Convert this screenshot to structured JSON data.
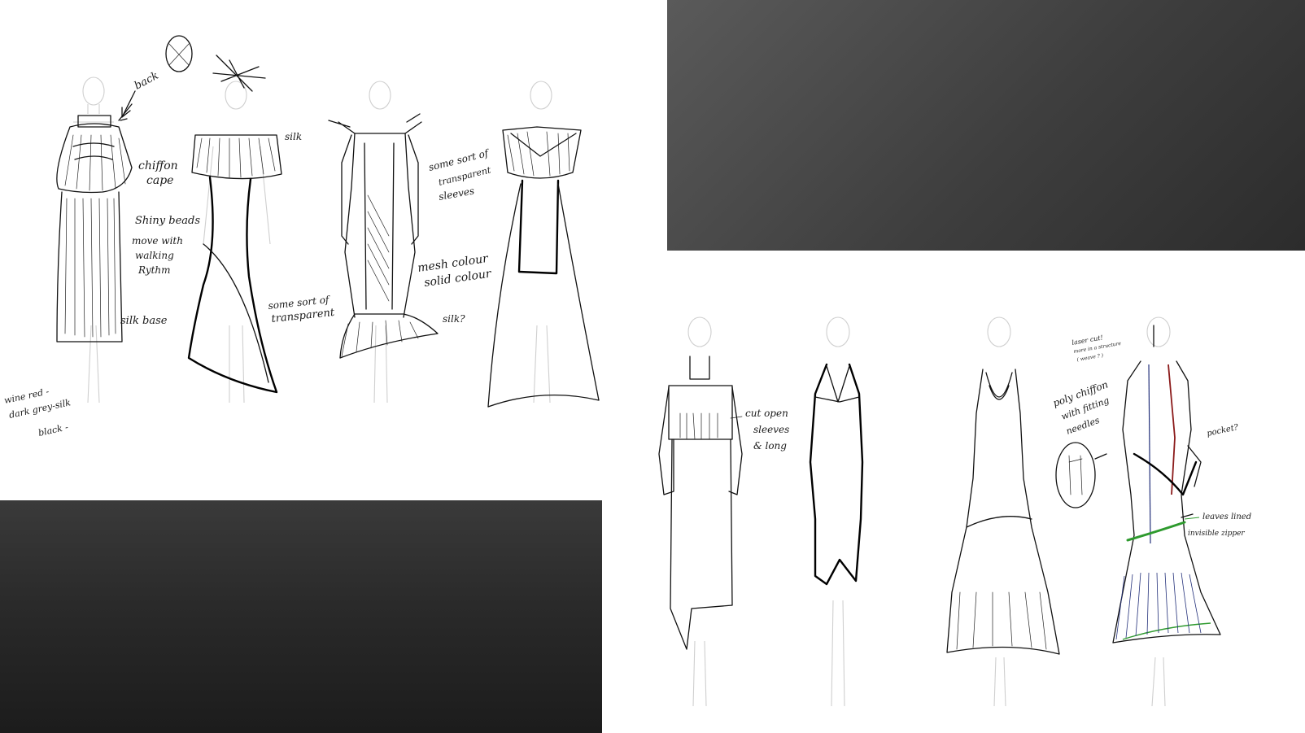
{
  "sheet1": {
    "notes": {
      "back": "back",
      "chiffon": [
        "chiffon",
        "cape"
      ],
      "beads": [
        "Shiny beads",
        "move with",
        "walking",
        "Rythm"
      ],
      "silk_base": "silk base",
      "colours": [
        "wine red -",
        "dark grey-silk",
        "black -"
      ],
      "silk1": "silk",
      "transparent_skirt": [
        "some sort of",
        "transparent"
      ],
      "sleeves": [
        "some sort of",
        "transparent",
        "sleeves"
      ],
      "mesh": "mesh colour",
      "solid": "solid colour",
      "silk2": "silk?"
    }
  },
  "sheet2": {
    "notes": {
      "cutopen": [
        "cut open",
        "sleeves",
        "& long"
      ],
      "laser": [
        "laser cut!",
        "more in a structure",
        "( weave ? )"
      ],
      "poly": [
        "poly chiffon",
        "with fitting",
        "needles"
      ],
      "pocket": "pocket?",
      "leaves": "leaves lined",
      "zipper": "invisible zipper"
    }
  },
  "colors": {
    "dark_panel": "#3e3e3e",
    "accent_red": "#8b1a1a",
    "accent_blue": "#23307a",
    "accent_green": "#2e9a2e"
  }
}
